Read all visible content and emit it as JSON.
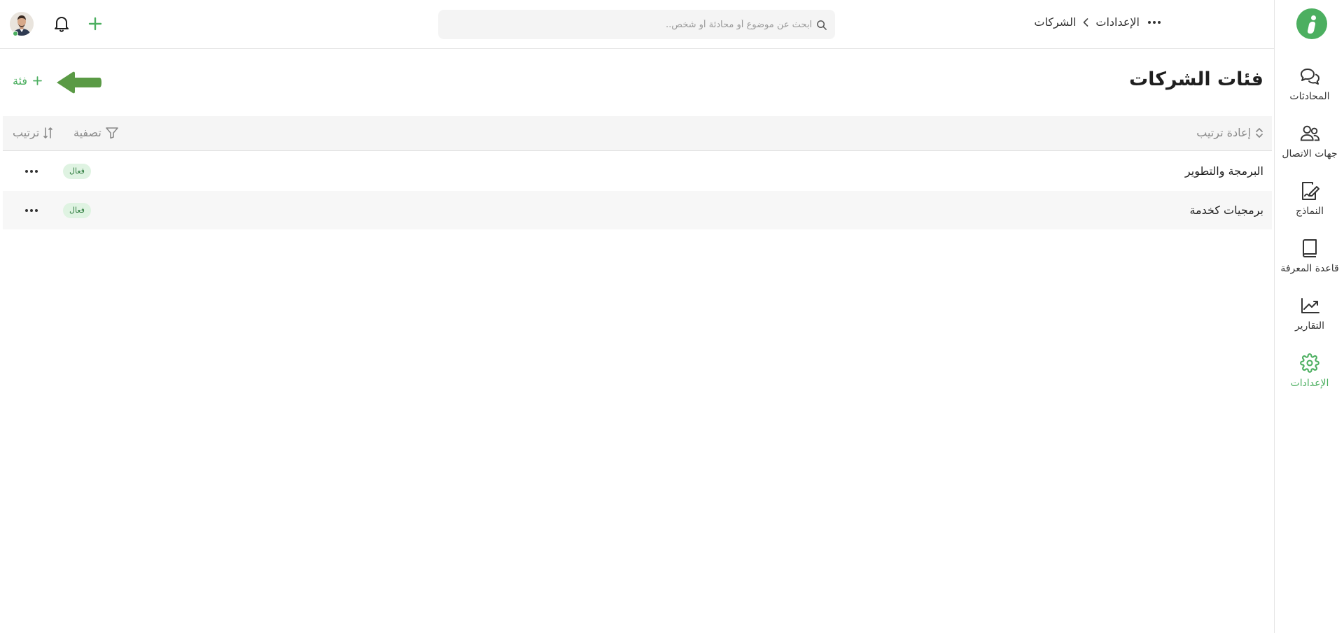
{
  "colors": {
    "accent": "#4caf60",
    "badge_bg": "#dff3e2",
    "badge_text": "#2f7d3f",
    "annotation_arrow": "#5a9a45"
  },
  "sidebar": {
    "logo_icon": "info-logo-icon",
    "items": [
      {
        "label": "المحادثات",
        "icon": "chat-bubbles-icon"
      },
      {
        "label": "جهات الاتصال",
        "icon": "contacts-icon"
      },
      {
        "label": "النماذج",
        "icon": "form-edit-icon"
      },
      {
        "label": "قاعدة المعرفة",
        "icon": "book-icon"
      },
      {
        "label": "التقارير",
        "icon": "trend-chart-icon"
      },
      {
        "label": "الإعدادات",
        "icon": "gear-icon",
        "active": true
      }
    ]
  },
  "topbar": {
    "search_placeholder": "ابحث عن موضوع أو محادثة أو شخص..",
    "breadcrumb": [
      "الإعدادات",
      "الشركات"
    ],
    "add_icon": "plus-icon",
    "notification_icon": "bell-icon",
    "avatar_status": "online"
  },
  "main": {
    "title": "فئات الشركات",
    "add_label": "فئة",
    "toolbar": {
      "reorder": "إعادة ترتيب",
      "filter": "تصفية",
      "sort": "ترتيب"
    },
    "rows": [
      {
        "name": "البرمجة والتطوير",
        "status": "فعال"
      },
      {
        "name": "برمجيات كخدمة",
        "status": "فعال"
      }
    ]
  }
}
